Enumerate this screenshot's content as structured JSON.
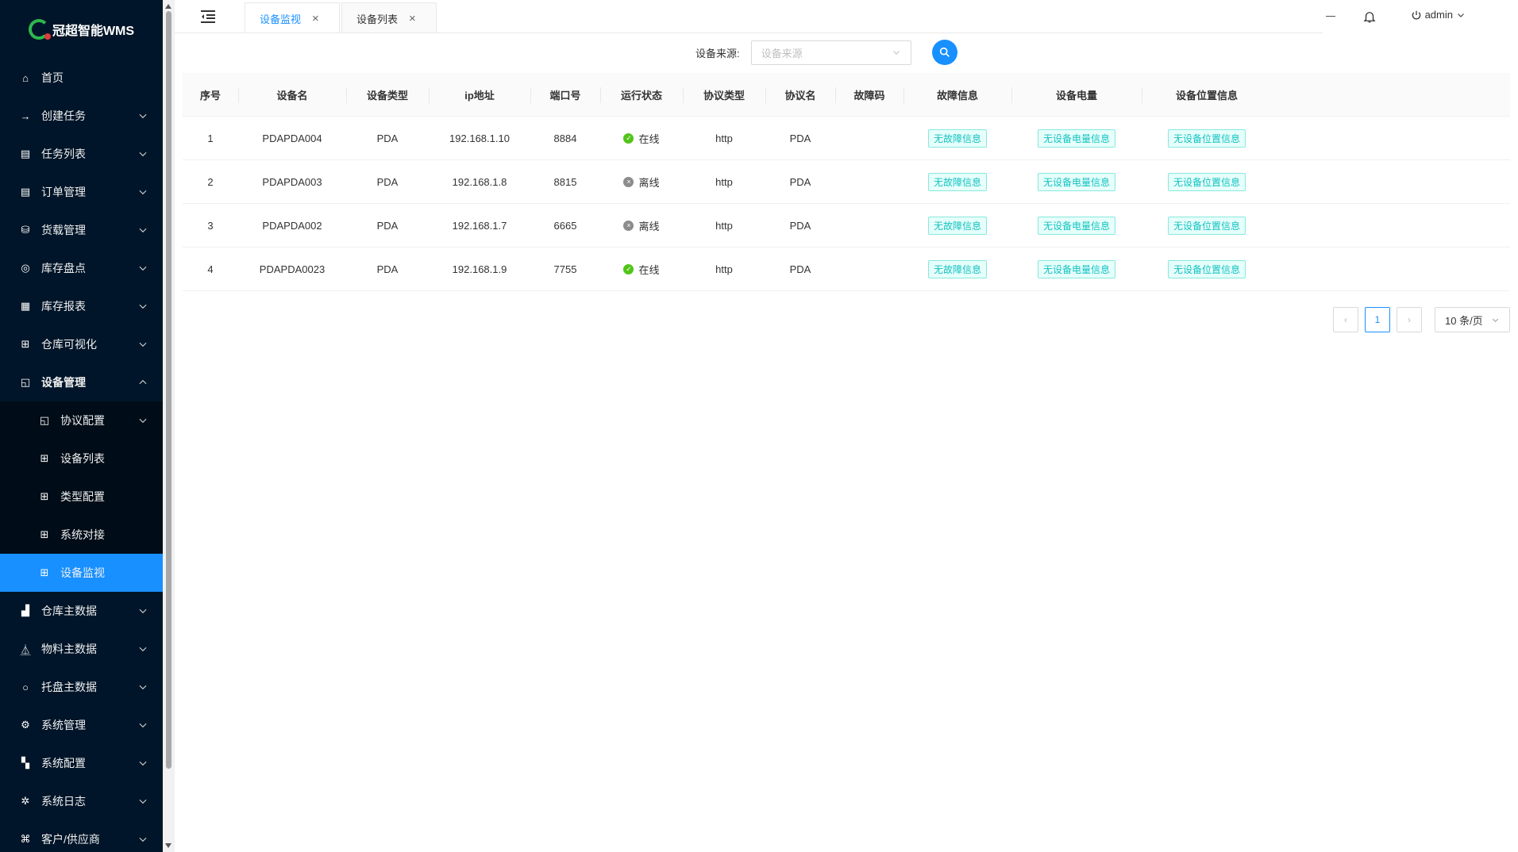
{
  "app": {
    "title": "冠超智能WMS"
  },
  "sidebar": {
    "items": [
      {
        "label": "首页",
        "icon": "home-icon",
        "has_arrow": false
      },
      {
        "label": "创建任务",
        "icon": "arrow-right-icon",
        "has_arrow": true
      },
      {
        "label": "任务列表",
        "icon": "list-icon",
        "has_arrow": true
      },
      {
        "label": "订单管理",
        "icon": "list-icon",
        "has_arrow": true
      },
      {
        "label": "货载管理",
        "icon": "database-icon",
        "has_arrow": true
      },
      {
        "label": "库存盘点",
        "icon": "compass-icon",
        "has_arrow": true
      },
      {
        "label": "库存报表",
        "icon": "file-icon",
        "has_arrow": true
      },
      {
        "label": "仓库可视化",
        "icon": "table-icon",
        "has_arrow": true
      },
      {
        "label": "设备管理",
        "icon": "devices-icon",
        "has_arrow": true,
        "open": true
      }
    ],
    "submenu": [
      {
        "label": "协议配置",
        "icon": "devices-icon",
        "has_arrow": true
      },
      {
        "label": "设备列表",
        "icon": "table-icon",
        "has_arrow": false
      },
      {
        "label": "类型配置",
        "icon": "table-icon",
        "has_arrow": false
      },
      {
        "label": "系统对接",
        "icon": "table-icon",
        "has_arrow": false
      },
      {
        "label": "设备监视",
        "icon": "table-icon",
        "has_arrow": false,
        "active": true
      }
    ],
    "items_after": [
      {
        "label": "仓库主数据",
        "icon": "bar-chart-icon",
        "has_arrow": true
      },
      {
        "label": "物料主数据",
        "icon": "experiment-icon",
        "has_arrow": true
      },
      {
        "label": "托盘主数据",
        "icon": "circle-icon",
        "has_arrow": true
      },
      {
        "label": "系统管理",
        "icon": "setting-icon",
        "has_arrow": true
      },
      {
        "label": "系统配置",
        "icon": "appstore-icon",
        "has_arrow": true
      },
      {
        "label": "系统日志",
        "icon": "bug-icon",
        "has_arrow": true
      },
      {
        "label": "客户/供应商",
        "icon": "cluster-icon",
        "has_arrow": true
      }
    ]
  },
  "header": {
    "tabs": [
      {
        "label": "设备监视",
        "active": true
      },
      {
        "label": "设备列表",
        "active": false
      }
    ],
    "user": "admin"
  },
  "filter": {
    "label": "设备来源:",
    "placeholder": "设备来源"
  },
  "table": {
    "columns": [
      "序号",
      "设备名",
      "设备类型",
      "ip地址",
      "端口号",
      "运行状态",
      "协议类型",
      "协议名",
      "故障码",
      "故障信息",
      "设备电量",
      "设备位置信息"
    ],
    "rows": [
      {
        "index": "1",
        "name": "PDAPDA004",
        "type": "PDA",
        "ip": "192.168.1.10",
        "port": "8884",
        "status": "在线",
        "online": true,
        "protocol_type": "http",
        "protocol_name": "PDA",
        "fault_code": "",
        "fault_info": "无故障信息",
        "battery": "无设备电量信息",
        "location": "无设备位置信息"
      },
      {
        "index": "2",
        "name": "PDAPDA003",
        "type": "PDA",
        "ip": "192.168.1.8",
        "port": "8815",
        "status": "离线",
        "online": false,
        "protocol_type": "http",
        "protocol_name": "PDA",
        "fault_code": "",
        "fault_info": "无故障信息",
        "battery": "无设备电量信息",
        "location": "无设备位置信息"
      },
      {
        "index": "3",
        "name": "PDAPDA002",
        "type": "PDA",
        "ip": "192.168.1.7",
        "port": "6665",
        "status": "离线",
        "online": false,
        "protocol_type": "http",
        "protocol_name": "PDA",
        "fault_code": "",
        "fault_info": "无故障信息",
        "battery": "无设备电量信息",
        "location": "无设备位置信息"
      },
      {
        "index": "4",
        "name": "PDAPDA0023",
        "type": "PDA",
        "ip": "192.168.1.9",
        "port": "7755",
        "status": "在线",
        "online": true,
        "protocol_type": "http",
        "protocol_name": "PDA",
        "fault_code": "",
        "fault_info": "无故障信息",
        "battery": "无设备电量信息",
        "location": "无设备位置信息"
      }
    ]
  },
  "pagination": {
    "current_page": "1",
    "page_size": "10 条/页"
  },
  "colors": {
    "sidebar_bg": "#001529",
    "accent": "#1890ff",
    "online": "#52c41a",
    "offline": "#8c8c8c",
    "tag": "#13c2c2"
  }
}
